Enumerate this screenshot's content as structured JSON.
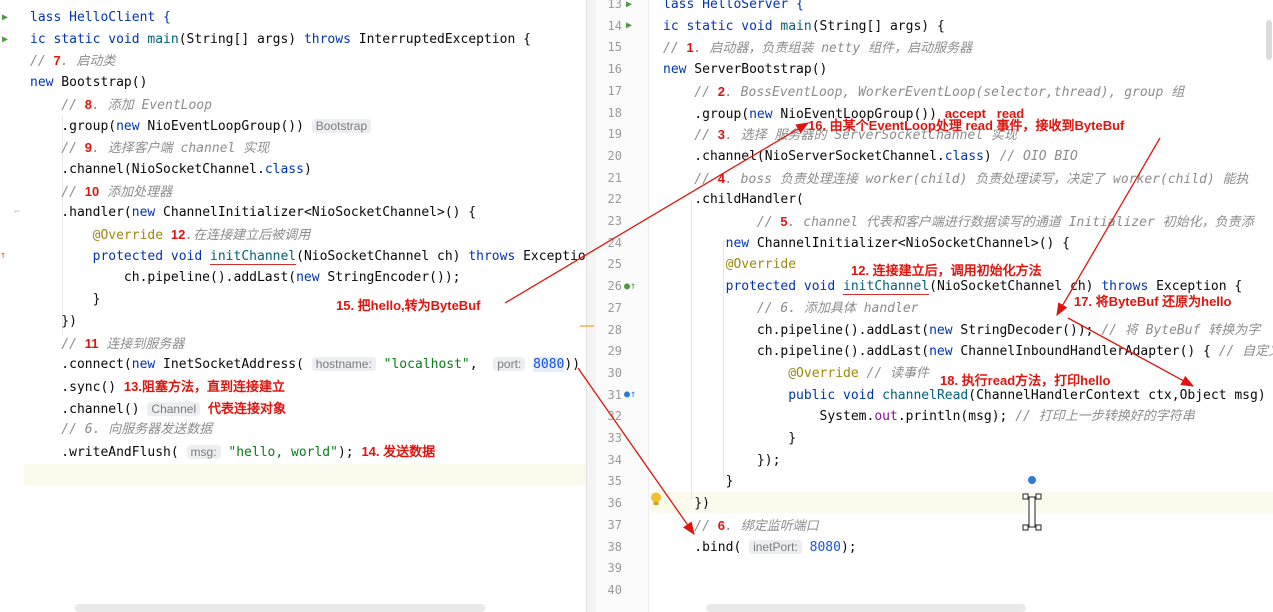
{
  "left_editor": {
    "lines": [
      [
        {
          "t": "lass HelloClient {",
          "cls": "k"
        }
      ],
      [
        {
          "t": "ic static void ",
          "cls": "k"
        },
        {
          "t": "main",
          "cls": "m"
        },
        {
          "t": "(String[] args) "
        },
        {
          "t": "throws",
          "cls": "k"
        },
        {
          "t": " InterruptedException {"
        }
      ],
      [
        {
          "t": "// ",
          "cls": "c"
        },
        {
          "t": "7",
          "cls": "red"
        },
        {
          "t": ". 启动类",
          "cls": "c"
        }
      ],
      [
        {
          "t": "new",
          "cls": "k"
        },
        {
          "t": " Bootstrap()"
        }
      ],
      [
        {
          "t": "    // ",
          "cls": "c"
        },
        {
          "t": "8",
          "cls": "red"
        },
        {
          "t": ". 添加 EventLoop",
          "cls": "c"
        }
      ],
      [
        {
          "t": "    .group("
        },
        {
          "t": "new",
          "cls": "k"
        },
        {
          "t": " NioEventLoopGroup()) "
        },
        {
          "t": "Bootstrap",
          "cls": "hint"
        }
      ],
      [
        {
          "t": "    // ",
          "cls": "c"
        },
        {
          "t": "9",
          "cls": "red"
        },
        {
          "t": ". 选择客户端 channel 实现",
          "cls": "c"
        }
      ],
      [
        {
          "t": "    .channel(NioSocketChannel."
        },
        {
          "t": "class",
          "cls": "k"
        },
        {
          "t": ")"
        }
      ],
      [
        {
          "t": "    // ",
          "cls": "c"
        },
        {
          "t": "10",
          "cls": "red"
        },
        {
          "t": " 添加处理器",
          "cls": "c"
        }
      ],
      [
        {
          "t": "    .handler("
        },
        {
          "t": "new",
          "cls": "k"
        },
        {
          "t": " ChannelInitializer<NioSocketChannel>() {"
        }
      ],
      [
        {
          "t": "        "
        },
        {
          "t": "@Override",
          "cls": "a"
        },
        {
          "t": " "
        },
        {
          "t": "12",
          "cls": "red"
        },
        {
          "t": ".在连接建立后被调用",
          "cls": "c"
        }
      ],
      [
        {
          "t": "        "
        },
        {
          "t": "protected void ",
          "cls": "k"
        },
        {
          "t": "initChannel",
          "cls": "m u"
        },
        {
          "t": "(NioSocketChannel ch) "
        },
        {
          "t": "throws",
          "cls": "k"
        },
        {
          "t": " Exception"
        }
      ],
      [
        {
          "t": "            ch.pipeline().addLast("
        },
        {
          "t": "new",
          "cls": "k"
        },
        {
          "t": " StringEncoder());"
        }
      ],
      [
        {
          "t": "        }"
        }
      ],
      [
        {
          "t": "    })"
        }
      ],
      [
        {
          "t": "    // ",
          "cls": "c"
        },
        {
          "t": "11",
          "cls": "red"
        },
        {
          "t": " 连接到服务器",
          "cls": "c"
        }
      ],
      [
        {
          "t": "    .connect("
        },
        {
          "t": "new",
          "cls": "k"
        },
        {
          "t": " InetSocketAddress( "
        },
        {
          "t": "hostname:",
          "cls": "hint"
        },
        {
          "t": " "
        },
        {
          "t": "\"localhost\"",
          "cls": "s"
        },
        {
          "t": ",  "
        },
        {
          "t": "port:",
          "cls": "hint"
        },
        {
          "t": " "
        },
        {
          "t": "8080",
          "cls": "num cursel"
        },
        {
          "t": ")) C"
        }
      ],
      [
        {
          "t": "    .sync() "
        },
        {
          "t": "13.阻塞方法，直到连接建立",
          "cls": "red"
        }
      ],
      [
        {
          "t": "    .channel() "
        },
        {
          "t": "Channel",
          "cls": "hint"
        },
        {
          "t": " "
        },
        {
          "t": "代表连接对象",
          "cls": "red"
        }
      ],
      [
        {
          "t": "    // 6. 向服务器发送数据",
          "cls": "c"
        }
      ],
      [
        {
          "t": "    .writeAndFlush( "
        },
        {
          "t": "msg:",
          "cls": "hint"
        },
        {
          "t": " "
        },
        {
          "t": "\"hello, world\"",
          "cls": "s"
        },
        {
          "t": "); "
        },
        {
          "t": "14. 发送数据",
          "cls": "red"
        }
      ]
    ]
  },
  "right_editor": {
    "line_numbers": [
      "13",
      "14",
      "15",
      "16",
      "17",
      "18",
      "19",
      "20",
      "21",
      "22",
      "23",
      "24",
      "25",
      "26",
      "27",
      "28",
      "29",
      "30",
      "31",
      "32",
      "33",
      "34",
      "35",
      "36",
      "37",
      "38",
      "39",
      "40"
    ],
    "lines": [
      [
        {
          "t": "lass HelloServer {",
          "cls": "k"
        }
      ],
      [
        {
          "t": "ic static void ",
          "cls": "k"
        },
        {
          "t": "main",
          "cls": "m"
        },
        {
          "t": "(String[] args) {"
        }
      ],
      [
        {
          "t": "// ",
          "cls": "c"
        },
        {
          "t": "1",
          "cls": "red"
        },
        {
          "t": ". 启动器，负责组装 netty 组件，启动服务器",
          "cls": "c"
        }
      ],
      [
        {
          "t": "new",
          "cls": "k"
        },
        {
          "t": " ServerBootstrap()"
        }
      ],
      [
        {
          "t": "    // ",
          "cls": "c"
        },
        {
          "t": "2",
          "cls": "red"
        },
        {
          "t": ". BossEventLoop, WorkerEventLoop(selector,thread), group 组",
          "cls": "c"
        }
      ],
      [
        {
          "t": "    .group("
        },
        {
          "t": "new",
          "cls": "k"
        },
        {
          "t": " NioEventLoopGroup()) "
        },
        {
          "t": "accept   read",
          "cls": "red"
        }
      ],
      [
        {
          "t": "    // ",
          "cls": "c"
        },
        {
          "t": "3",
          "cls": "red"
        },
        {
          "t": ". 选择 服务器的 ServerSocketChannel 实现",
          "cls": "c"
        }
      ],
      [
        {
          "t": "    .channel(NioServerSocketChannel."
        },
        {
          "t": "class",
          "cls": "k"
        },
        {
          "t": ") "
        },
        {
          "t": "// OIO BIO",
          "cls": "c"
        }
      ],
      [
        {
          "t": "    // ",
          "cls": "c"
        },
        {
          "t": "4",
          "cls": "red"
        },
        {
          "t": ". boss 负责处理连接 worker(child) 负责处理读写，决定了 worker(child) 能执",
          "cls": "c"
        }
      ],
      [
        {
          "t": "    .childHandler("
        }
      ],
      [
        {
          "t": "            // ",
          "cls": "c"
        },
        {
          "t": "5",
          "cls": "red"
        },
        {
          "t": ". channel 代表和客户端进行数据读写的通道 Initializer 初始化，负责添",
          "cls": "c"
        }
      ],
      [
        {
          "t": "        "
        },
        {
          "t": "new",
          "cls": "k"
        },
        {
          "t": " ChannelInitializer<NioSocketChannel>() {"
        }
      ],
      [
        {
          "t": "        "
        },
        {
          "t": "@Override",
          "cls": "a"
        }
      ],
      [
        {
          "t": "        "
        },
        {
          "t": "protected void ",
          "cls": "k"
        },
        {
          "t": "initChannel",
          "cls": "m u"
        },
        {
          "t": "(NioSocketChannel ch) "
        },
        {
          "t": "throws",
          "cls": "k"
        },
        {
          "t": " Exception {"
        }
      ],
      [
        {
          "t": "            // 6. 添加具体 handler",
          "cls": "c"
        }
      ],
      [
        {
          "t": "            ch.pipeline().addLast("
        },
        {
          "t": "new",
          "cls": "k"
        },
        {
          "t": " StringDecoder()); "
        },
        {
          "t": "// 将 ByteBuf 转换为字",
          "cls": "c"
        }
      ],
      [
        {
          "t": "            ch.pipeline().addLast("
        },
        {
          "t": "new",
          "cls": "k"
        },
        {
          "t": " ChannelInboundHandlerAdapter() { "
        },
        {
          "t": "// 自定义",
          "cls": "c"
        }
      ],
      [
        {
          "t": "                "
        },
        {
          "t": "@Override",
          "cls": "a"
        },
        {
          "t": " "
        },
        {
          "t": "// 读事件",
          "cls": "c"
        }
      ],
      [
        {
          "t": "                "
        },
        {
          "t": "public void ",
          "cls": "k"
        },
        {
          "t": "channelRead",
          "cls": "m"
        },
        {
          "t": "(ChannelHandlerContext ctx,Object msg)"
        }
      ],
      [
        {
          "t": "                    System."
        },
        {
          "t": "out",
          "cls": "f"
        },
        {
          "t": ".println(msg); "
        },
        {
          "t": "// 打印上一步转换好的字符串",
          "cls": "c"
        }
      ],
      [
        {
          "t": "                }"
        }
      ],
      [
        {
          "t": "            });"
        }
      ],
      [
        {
          "t": "        }"
        }
      ],
      [
        {
          "t": "    })"
        }
      ],
      [
        {
          "t": "    // ",
          "cls": "c"
        },
        {
          "t": "6",
          "cls": "red"
        },
        {
          "t": ". 绑定监听端口",
          "cls": "c"
        }
      ],
      [
        {
          "t": "    .bind( "
        },
        {
          "t": "inetPort:",
          "cls": "hint"
        },
        {
          "t": " "
        },
        {
          "t": "8080",
          "cls": "num"
        },
        {
          "t": ");"
        }
      ],
      [
        {
          "t": ""
        }
      ],
      [
        {
          "t": ""
        }
      ]
    ]
  },
  "annotations": {
    "a15": "15. 把hello,转为ByteBuf",
    "a16": "16. 由某个EventLoop处理 read 事件，接收到ByteBuf",
    "a12": "12. 连接建立后，调用初始化方法",
    "a17": "17. 将ByteBuf 还原为hello",
    "a18": "18. 执行read方法，打印hello"
  },
  "colors": {
    "keyword": "#0033b3",
    "comment": "#8c8c8c",
    "string": "#067d17",
    "annotation_red": "#e0140e",
    "current_line": "#fcfaed"
  }
}
